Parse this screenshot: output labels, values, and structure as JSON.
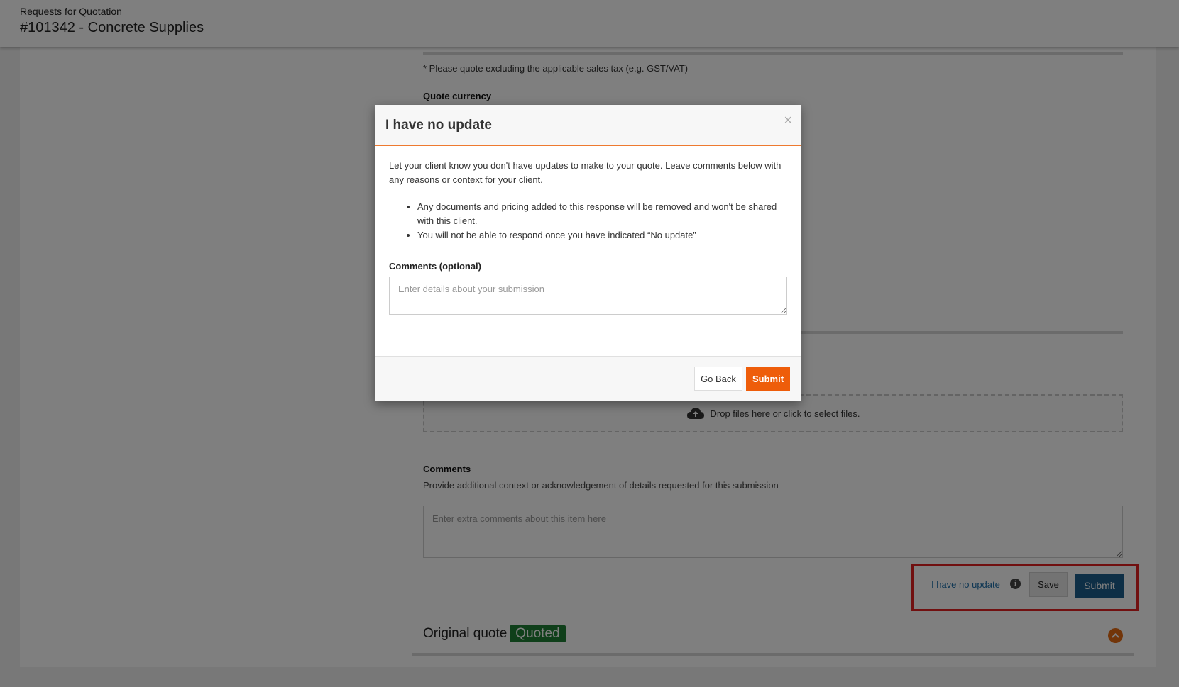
{
  "header": {
    "breadcrumb": "Requests for Quotation",
    "title": "#101342 - Concrete Supplies"
  },
  "form": {
    "tax_note": "* Please quote excluding the applicable sales tax (e.g. GST/VAT)",
    "currency_label": "Quote currency",
    "dropzone_text": "Drop files here or click to select files.",
    "comments_label": "Comments",
    "comments_help": "Provide additional context or acknowledgement of details requested for this submission",
    "comments_placeholder": "Enter extra comments about this item here"
  },
  "actions": {
    "no_update_label": "I have no update",
    "info_icon": "i",
    "save_label": "Save",
    "submit_label": "Submit"
  },
  "original_quote": {
    "label": "Original quote",
    "status": "Quoted"
  },
  "modal": {
    "title": "I have no update",
    "close_symbol": "×",
    "intro": "Let your client know you don't have updates to make to your quote. Leave comments below with any reasons or context for your client.",
    "bullets": [
      "Any documents and pricing added to this response will be removed and won't be shared with this client.",
      "You will not be able to respond once you have indicated “No update”"
    ],
    "comments_label": "Comments (optional)",
    "comments_placeholder": "Enter details about your submission",
    "goback_label": "Go Back",
    "submit_label": "Submit"
  },
  "colors": {
    "accent_orange": "#ee5d0a",
    "primary_blue": "#1d5f8c",
    "quoted_green": "#1e7e34",
    "highlight_red": "#e32121"
  }
}
